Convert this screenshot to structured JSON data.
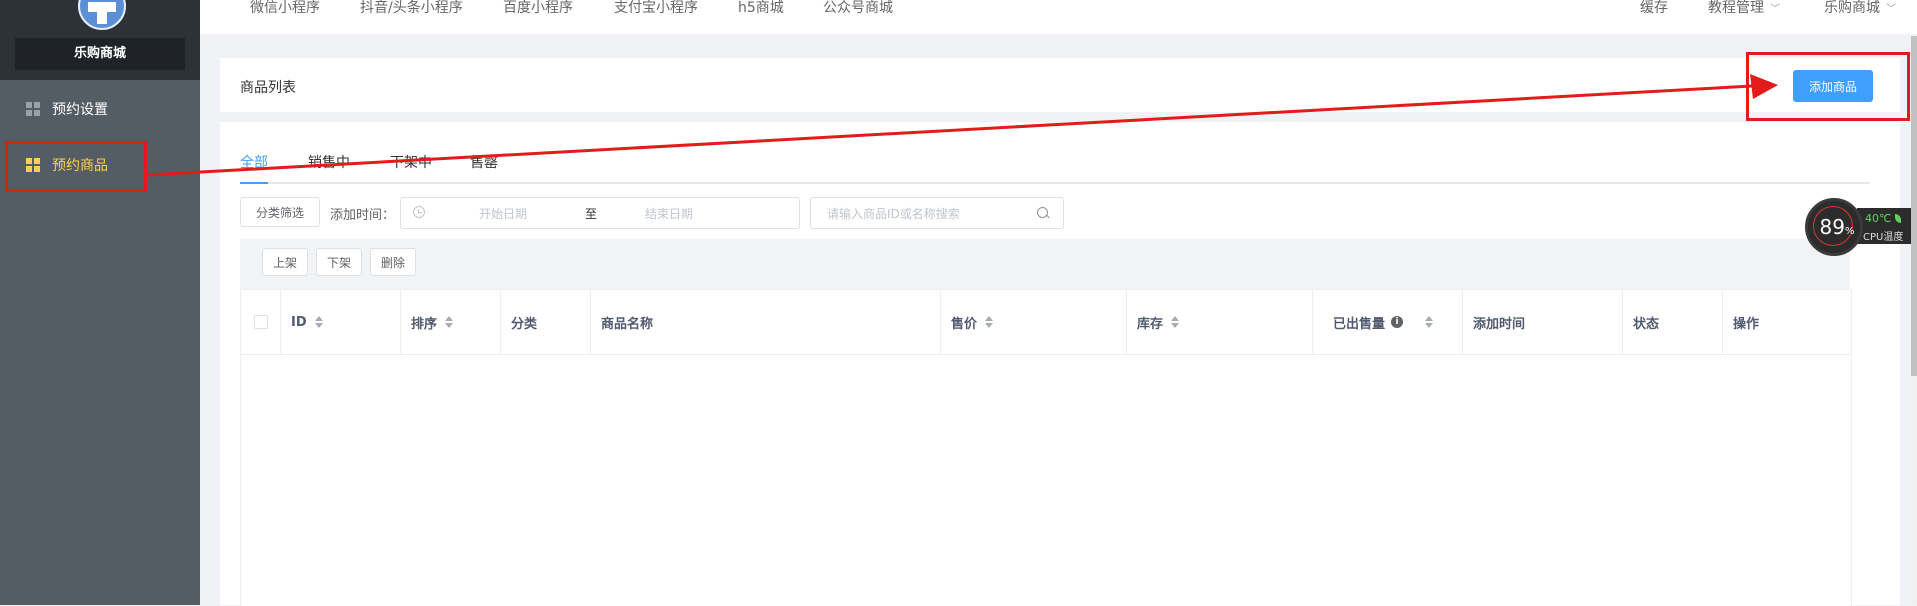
{
  "brand": {
    "name": "乐购商城"
  },
  "sidebar": {
    "items": [
      {
        "label": "预约设置",
        "active": false
      },
      {
        "label": "预约商品",
        "active": true
      }
    ]
  },
  "topnav": {
    "links": [
      "微信小程序",
      "抖音/头条小程序",
      "百度小程序",
      "支付宝小程序",
      "h5商城",
      "公众号商城"
    ],
    "right": {
      "cache": "缓存",
      "tutorial": "教程管理",
      "store": "乐购商城"
    }
  },
  "page": {
    "title": "商品列表",
    "add_button": "添加商品"
  },
  "tabs": [
    {
      "label": "全部",
      "active": true
    },
    {
      "label": "销售中",
      "active": false
    },
    {
      "label": "下架中",
      "active": false
    },
    {
      "label": "售罄",
      "active": false
    }
  ],
  "filters": {
    "category_button": "分类筛选",
    "date_label": "添加时间：",
    "start_placeholder": "开始日期",
    "separator": "至",
    "end_placeholder": "结束日期",
    "search_placeholder": "请输入商品ID或名称搜索"
  },
  "toolbar": {
    "on_shelf": "上架",
    "off_shelf": "下架",
    "delete": "删除"
  },
  "table": {
    "columns": [
      "ID",
      "排序",
      "分类",
      "商品名称",
      "售价",
      "库存",
      "已出售量",
      "添加时间",
      "状态",
      "操作"
    ],
    "rows": []
  },
  "cpu": {
    "percent": "89",
    "percent_unit": "%",
    "temperature": "40℃",
    "caption": "CPU温度"
  },
  "colors": {
    "accent": "#409eff",
    "sidebar": "#545c64",
    "active": "#ffd04b",
    "annotation": "#e31b1b"
  }
}
